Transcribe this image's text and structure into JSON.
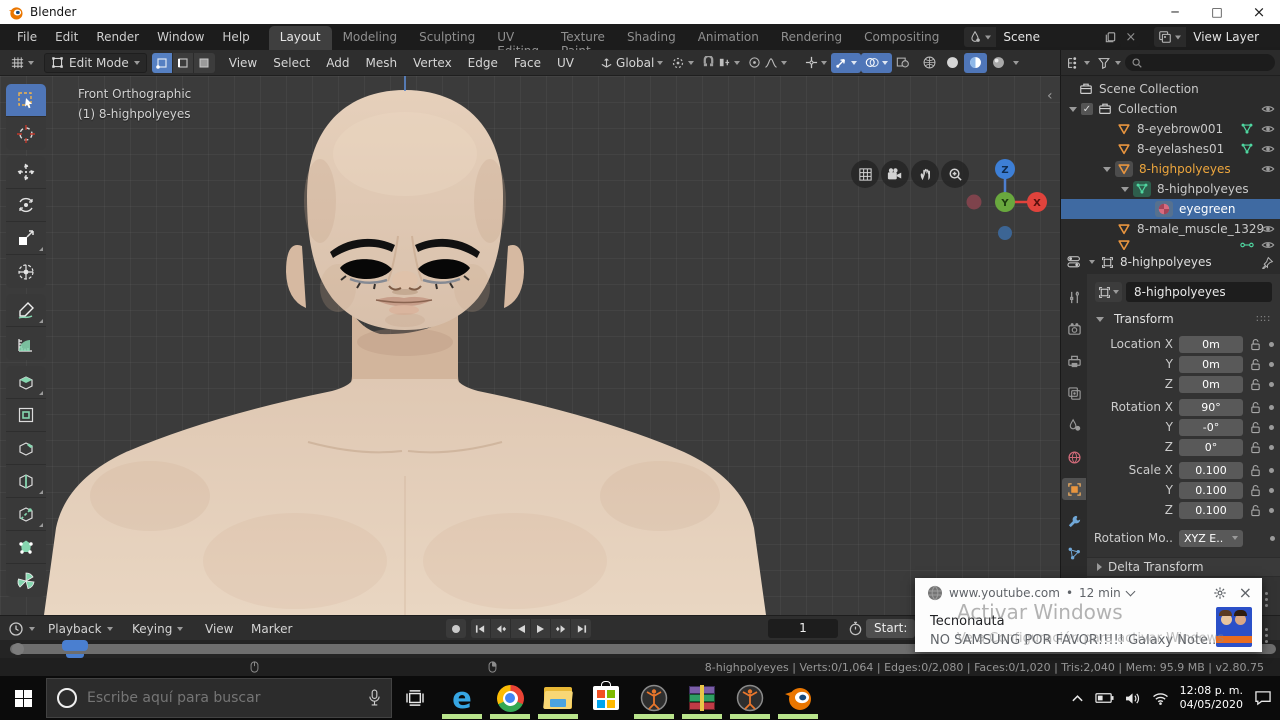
{
  "window": {
    "title": "Blender"
  },
  "topbar": {
    "menus": [
      "File",
      "Edit",
      "Render",
      "Window",
      "Help"
    ],
    "tabs": [
      "Layout",
      "Modeling",
      "Sculpting",
      "UV Editing",
      "Texture Paint",
      "Shading",
      "Animation",
      "Rendering",
      "Compositing"
    ],
    "scene_label": "Scene",
    "view_layer_label": "View Layer"
  },
  "viewport_header": {
    "mode": "Edit Mode",
    "menus": [
      "View",
      "Select",
      "Add",
      "Mesh",
      "Vertex",
      "Edge",
      "Face",
      "UV"
    ],
    "orientation": "Global"
  },
  "viewport": {
    "overlay_line1": "Front Orthographic",
    "overlay_line2": "(1) 8-highpolyeyes",
    "gizmo": {
      "x": "X",
      "y": "Y",
      "z": "Z"
    }
  },
  "outliner": {
    "rows": [
      {
        "label": "Scene Collection"
      },
      {
        "label": "Collection"
      },
      {
        "label": "8-eyebrow001"
      },
      {
        "label": "8-eyelashes01"
      },
      {
        "label": "8-highpolyeyes"
      },
      {
        "label": "8-highpolyeyes"
      },
      {
        "label": "eyegreen"
      },
      {
        "label": "8-male_muscle_1329"
      }
    ]
  },
  "properties": {
    "breadcrumb": "8-highpolyeyes",
    "name_field": "8-highpolyeyes",
    "transform": {
      "title": "Transform",
      "rows": [
        {
          "label": "Location X",
          "value": "0m"
        },
        {
          "label": "Y",
          "value": "0m"
        },
        {
          "label": "Z",
          "value": "0m"
        },
        {
          "label": "Rotation X",
          "value": "90°"
        },
        {
          "label": "Y",
          "value": "-0°"
        },
        {
          "label": "Z",
          "value": "0°"
        },
        {
          "label": "Scale X",
          "value": "0.100"
        },
        {
          "label": "Y",
          "value": "0.100"
        },
        {
          "label": "Z",
          "value": "0.100"
        }
      ],
      "rotation_mode_label": "Rotation Mo..",
      "rotation_mode_value": "XYZ E..",
      "delta_label": "Delta Transform"
    }
  },
  "timeline": {
    "menus": [
      "Playback",
      "Keying",
      "View",
      "Marker"
    ],
    "frame_value": "1",
    "start_label": "Start:"
  },
  "status_bar": {
    "text": "8-highpolyeyes | Verts:0/1,064 | Edges:0/2,080 | Faces:0/1,020 | Tris:2,040 | Mem: 95.9 MB | v2.80.75"
  },
  "notification": {
    "source": "www.youtube.com",
    "dot": "•",
    "time": "12 min",
    "title": "Tecnonauta",
    "body": "NO SAMSUNG POR FAVOR!!!!! Galaxy Note..",
    "watermark_line1": "Activar Windows",
    "watermark_line2": "Ve a Configuración para activar Windows"
  },
  "taskbar": {
    "search_placeholder": "Escribe aquí para buscar",
    "clock_time": "12:08 p. m.",
    "clock_date": "04/05/2020"
  }
}
